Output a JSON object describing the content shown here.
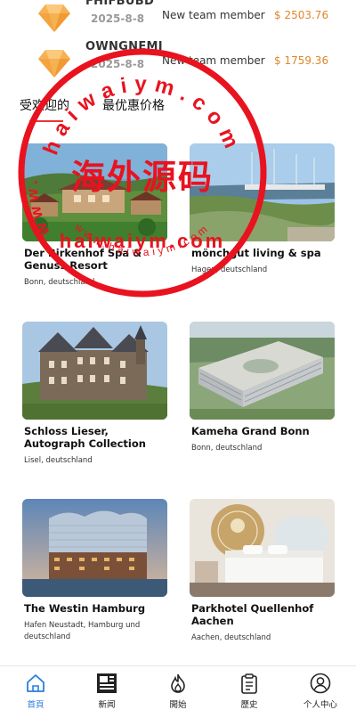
{
  "members": [
    {
      "name": "FHIFBUBD",
      "date": "2025-8-8",
      "status": "New team member",
      "amount": "$ 2503.76"
    },
    {
      "name": "OWNGNEMI",
      "date": "2025-8-8",
      "status": "New team member",
      "amount": "$ 1759.36"
    }
  ],
  "tabs": [
    "受欢迎的",
    "最优惠价格"
  ],
  "hotels": [
    {
      "title": "Der Birkenhof Spa & Genuss Resort",
      "location": "Bonn, deutschland"
    },
    {
      "title": "mönchgut living & spa",
      "location": "Hagen, deutschland"
    },
    {
      "title": "Schloss Lieser, Autograph Collection",
      "location": "Lisel, deutschland"
    },
    {
      "title": "Kameha Grand Bonn",
      "location": "Bonn, deutschland"
    },
    {
      "title": "The Westin Hamburg",
      "location": "Hafen Neustadt, Hamburg und deutschland"
    },
    {
      "title": "Parkhotel Quellenhof Aachen",
      "location": "Aachen, deutschland"
    }
  ],
  "tabbar": [
    "首頁",
    "新闻",
    "開始",
    "歷史",
    "个人中心"
  ],
  "watermark": {
    "ring_top": "haiwaiym.com",
    "ring_left": "www.",
    "ring_bottom": "www.haiwaiym.com",
    "center": "海外源码",
    "url": "haiwaiym.com"
  },
  "colors": {
    "accent": "#2b7de1",
    "amount": "#e0872a",
    "watermark": "#e8131f",
    "tab_underline": "#e33"
  }
}
